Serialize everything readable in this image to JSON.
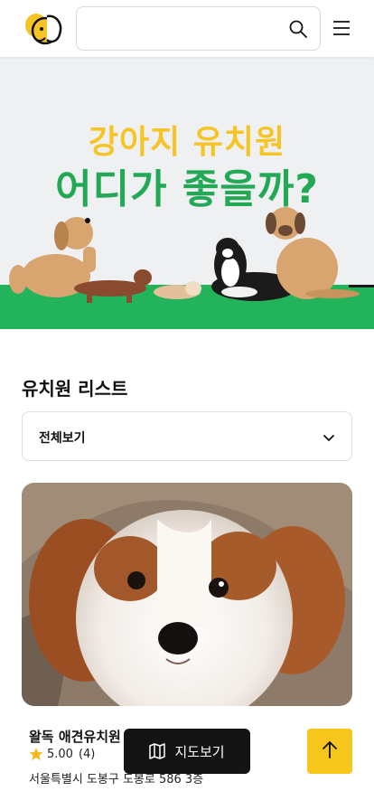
{
  "header": {
    "logo_icon": "puppy-logo-icon",
    "search": {
      "value": "",
      "placeholder": ""
    },
    "search_icon": "search-icon",
    "menu_icon": "hamburger-menu-icon"
  },
  "hero": {
    "line1": "강아지 유치원",
    "line2": "어디가 좋을까?",
    "line1_color": "#f6c425",
    "line2_color": "#23a956",
    "ground_color": "#23b35a"
  },
  "section": {
    "title": "유치원 리스트",
    "filter": {
      "selected": "전체보기",
      "icon": "chevron-down-icon"
    }
  },
  "listing": {
    "name": "왈독 애견유치원",
    "rating": "5.00",
    "review_count": "(4)",
    "address": "서울특별시 도봉구 도봉로 586 3층"
  },
  "floating": {
    "map_button_label": "지도보기",
    "map_icon": "map-icon",
    "top_icon": "arrow-up-icon",
    "accent_color": "#f7c61c"
  }
}
